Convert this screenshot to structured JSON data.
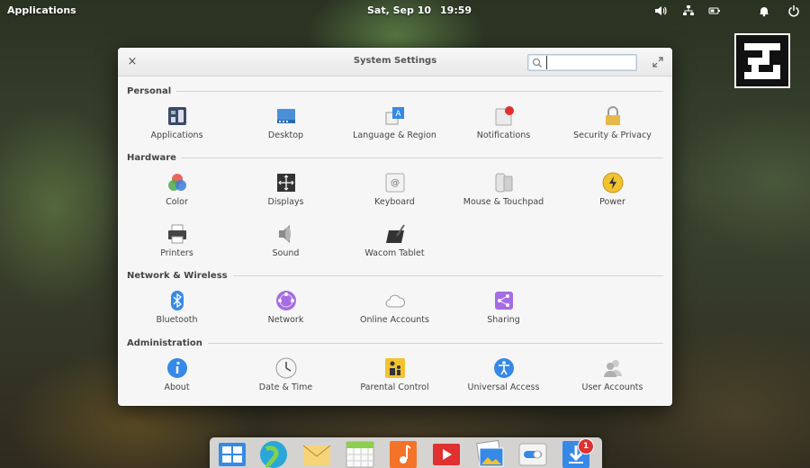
{
  "panel": {
    "apps_label": "Applications",
    "date": "Sat, Sep 10",
    "time": "19:59"
  },
  "window": {
    "title": "System Settings",
    "close_glyph": "×",
    "search_value": ""
  },
  "sections": {
    "personal": {
      "title": "Personal",
      "items": [
        {
          "label": "Applications",
          "icon": "applications-icon"
        },
        {
          "label": "Desktop",
          "icon": "desktop-icon"
        },
        {
          "label": "Language & Region",
          "icon": "language-icon"
        },
        {
          "label": "Notifications",
          "icon": "notifications-icon"
        },
        {
          "label": "Security & Privacy",
          "icon": "lock-icon"
        }
      ]
    },
    "hardware": {
      "title": "Hardware",
      "items": [
        {
          "label": "Color",
          "icon": "color-icon"
        },
        {
          "label": "Displays",
          "icon": "displays-icon"
        },
        {
          "label": "Keyboard",
          "icon": "keyboard-icon"
        },
        {
          "label": "Mouse & Touchpad",
          "icon": "mouse-icon"
        },
        {
          "label": "Power",
          "icon": "power-icon"
        },
        {
          "label": "Printers",
          "icon": "printer-icon"
        },
        {
          "label": "Sound",
          "icon": "speaker-icon"
        },
        {
          "label": "Wacom Tablet",
          "icon": "tablet-icon"
        }
      ]
    },
    "network": {
      "title": "Network & Wireless",
      "items": [
        {
          "label": "Bluetooth",
          "icon": "bluetooth-icon"
        },
        {
          "label": "Network",
          "icon": "network-icon"
        },
        {
          "label": "Online Accounts",
          "icon": "cloud-icon"
        },
        {
          "label": "Sharing",
          "icon": "share-icon"
        }
      ]
    },
    "admin": {
      "title": "Administration",
      "items": [
        {
          "label": "About",
          "icon": "info-icon"
        },
        {
          "label": "Date & Time",
          "icon": "clock-icon"
        },
        {
          "label": "Parental Control",
          "icon": "parental-icon"
        },
        {
          "label": "Universal Access",
          "icon": "accessibility-icon"
        },
        {
          "label": "User Accounts",
          "icon": "users-icon"
        }
      ]
    }
  },
  "dock": {
    "items": [
      "multitasking-view-icon",
      "browser-icon",
      "mail-icon",
      "calendar-icon",
      "music-icon",
      "videos-icon",
      "photos-icon",
      "settings-switch-icon",
      "appcenter-icon"
    ],
    "appcenter_badge": "1"
  },
  "colors": {
    "window_bg": "#f6f6f6",
    "accent": "#3689e6",
    "badge": "#e03030"
  }
}
